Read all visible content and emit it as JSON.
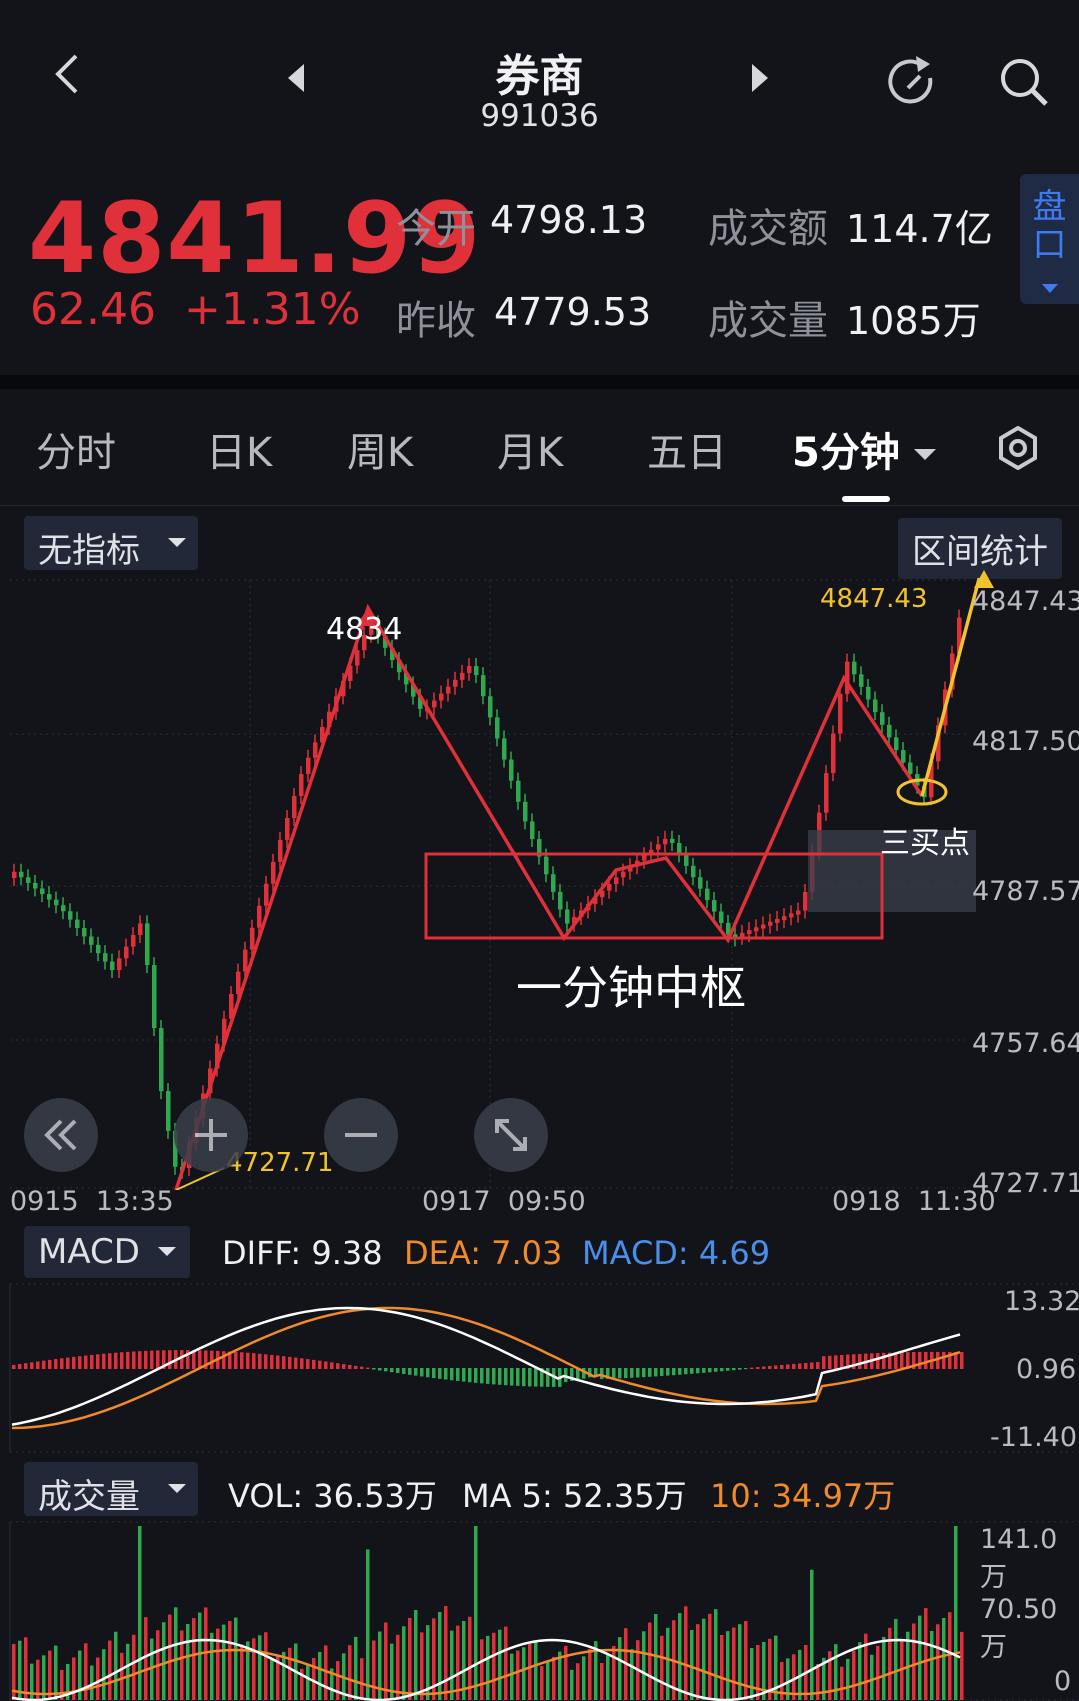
{
  "header": {
    "title": "券商",
    "code": "991036"
  },
  "quote": {
    "price": "4841.99",
    "change": "62.46",
    "change_pct": "+1.31%",
    "open_label": "今开",
    "open": "4798.13",
    "prev_label": "昨收",
    "prev": "4779.53",
    "amount_label": "成交额",
    "amount": "114.7亿",
    "volume_label": "成交量",
    "volume": "1085万",
    "pankou_label": "盘口"
  },
  "tabs": [
    {
      "label": "分时"
    },
    {
      "label": "日K"
    },
    {
      "label": "周K"
    },
    {
      "label": "月K"
    },
    {
      "label": "五日"
    },
    {
      "label": "5分钟"
    }
  ],
  "main_chart": {
    "indicator_label": "无指标",
    "range_stat_label": "区间统计",
    "y_ticks": [
      "4847.43",
      "4817.50",
      "4787.57",
      "4757.64",
      "4727.71"
    ],
    "x_ticks": [
      "0915  13:35",
      "0917  09:50",
      "0918  11:30"
    ],
    "high_label": "4847.43",
    "low_label": "4727.71",
    "peak_label": "4834",
    "annotation_center": "一分钟中枢",
    "annotation_buy": "三买点"
  },
  "macd": {
    "label": "MACD",
    "diff": "DIFF: 9.38",
    "dea": "DEA: 7.03",
    "macd": "MACD: 4.69",
    "y_ticks": [
      "13.32",
      "0.96",
      "-11.40"
    ]
  },
  "volume": {
    "label": "成交量",
    "vol": "VOL: 36.53万",
    "ma5": "MA 5: 52.35万",
    "ma10": "10: 34.97万",
    "y_ticks": [
      "141.0万",
      "70.50万",
      "0"
    ]
  },
  "colors": {
    "up": "#e0313a",
    "down": "#2fa84f",
    "dea": "#f08a2a",
    "macd": "#4a8fe8",
    "annotation": "#f2c230"
  }
}
